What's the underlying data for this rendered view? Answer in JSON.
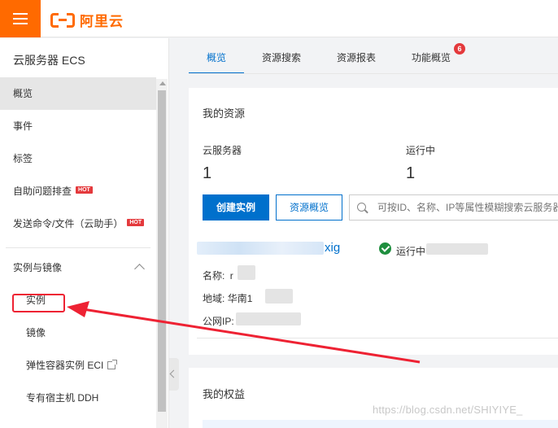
{
  "header": {
    "logo_text": "阿里云"
  },
  "sidebar": {
    "title": "云服务器 ECS",
    "items": [
      {
        "label": "概览",
        "active": true
      },
      {
        "label": "事件"
      },
      {
        "label": "标签"
      },
      {
        "label": "自助问题排查",
        "badge": "HOT"
      },
      {
        "label": "发送命令/文件（云助手）",
        "badge": "HOT"
      }
    ],
    "group": {
      "label": "实例与镜像",
      "items": [
        {
          "label": "实例"
        },
        {
          "label": "镜像"
        },
        {
          "label": "弹性容器实例 ECI"
        },
        {
          "label": "专有宿主机 DDH"
        }
      ]
    }
  },
  "tabs": [
    {
      "label": "概览",
      "active": true
    },
    {
      "label": "资源搜索"
    },
    {
      "label": "资源报表"
    },
    {
      "label": "功能概览",
      "badge": "6"
    }
  ],
  "resources": {
    "title": "我的资源",
    "stats": [
      {
        "label": "云服务器",
        "value": "1"
      },
      {
        "label": "运行中",
        "value": "1"
      }
    ],
    "create_button": "创建实例",
    "overview_button": "资源概览",
    "search_placeholder": "可按ID、名称、IP等属性模糊搜索云服务器",
    "instance": {
      "id_suffix": "xig",
      "status": "运行中",
      "name_label": "名称:",
      "name_value": "r",
      "region_label": "地域:",
      "region_value": "华南1",
      "ip_label": "公网IP:"
    }
  },
  "rights": {
    "title": "我的权益"
  },
  "watermark": "https://blog.csdn.net/SHIYIYE_",
  "colors": {
    "brand": "#ff6a00",
    "primary": "#0070cc",
    "hot": "#e4393c",
    "success": "#1e8e3e",
    "annotation": "#ee2233"
  }
}
